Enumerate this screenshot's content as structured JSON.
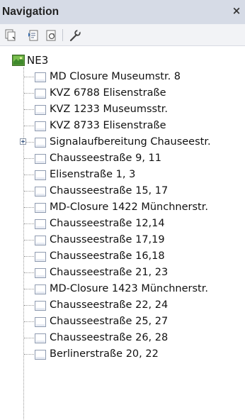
{
  "panel": {
    "title": "Navigation",
    "close_glyph": "×",
    "toolbar": [
      {
        "name": "collapse-all-icon"
      },
      {
        "name": "expand-select-icon"
      },
      {
        "name": "refresh-icon"
      },
      {
        "name": "wrench-icon"
      }
    ]
  },
  "tree": {
    "root": {
      "label": "NE3",
      "icon": "map-layer-icon"
    },
    "items": [
      {
        "label": "MD Closure Museumstr. 8",
        "icon": "node-icon",
        "expandable": false
      },
      {
        "label": "KVZ 6788 Elisenstraße",
        "icon": "node-icon",
        "expandable": false
      },
      {
        "label": "KVZ 1233 Museumsstr.",
        "icon": "node-icon",
        "expandable": false
      },
      {
        "label": "KVZ 8733 Elisenstraße",
        "icon": "node-icon",
        "expandable": false
      },
      {
        "label": "Signalaufbereitung Chauseestr.",
        "icon": "node-icon",
        "expandable": true
      },
      {
        "label": "Chausseestraße  9, 11",
        "icon": "node-icon",
        "expandable": false
      },
      {
        "label": "Elisenstraße 1, 3",
        "icon": "node-icon",
        "expandable": false
      },
      {
        "label": "Chausseestraße  15, 17",
        "icon": "node-icon",
        "expandable": false
      },
      {
        "label": "MD-Closure 1422 Münchnerstr.",
        "icon": "node-icon",
        "expandable": false
      },
      {
        "label": "Chausseestraße  12,14",
        "icon": "node-icon",
        "expandable": false
      },
      {
        "label": "Chausseestraße  17,19",
        "icon": "node-icon",
        "expandable": false
      },
      {
        "label": "Chausseestraße  16,18",
        "icon": "node-icon",
        "expandable": false
      },
      {
        "label": "Chausseestraße  21, 23",
        "icon": "node-icon",
        "expandable": false
      },
      {
        "label": "MD-Closure 1423 Münchnerstr.",
        "icon": "node-icon",
        "expandable": false
      },
      {
        "label": "Chausseestraße  22, 24",
        "icon": "node-icon",
        "expandable": false
      },
      {
        "label": "Chausseestraße  25, 27",
        "icon": "node-icon",
        "expandable": false
      },
      {
        "label": "Chausseestraße  26, 28",
        "icon": "node-icon",
        "expandable": false
      },
      {
        "label": "Berlinerstraße 20, 22",
        "icon": "node-icon",
        "expandable": false
      }
    ]
  }
}
